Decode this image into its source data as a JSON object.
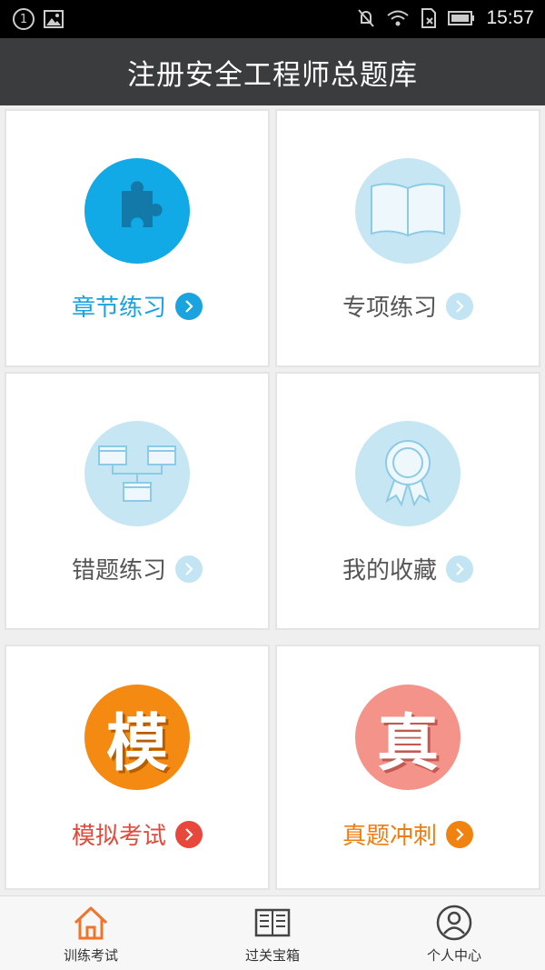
{
  "status_bar": {
    "notification_count": "1",
    "time": "15:57"
  },
  "header": {
    "title": "注册安全工程师总题库"
  },
  "cards": [
    {
      "label": "章节练习",
      "icon": "puzzle-icon",
      "label_color": "#1aa3df",
      "circle_color": "#11a9e6",
      "chevron_color": "#1aa3df"
    },
    {
      "label": "专项练习",
      "icon": "book-icon",
      "label_color": "#555555",
      "circle_color": "#c7e6f4",
      "chevron_color": "#c2e4f3"
    },
    {
      "label": "错题练习",
      "icon": "diagram-icon",
      "label_color": "#555555",
      "circle_color": "#c7e6f4",
      "chevron_color": "#c2e4f3"
    },
    {
      "label": "我的收藏",
      "icon": "award-ribbon-icon",
      "label_color": "#555555",
      "circle_color": "#c7e6f4",
      "chevron_color": "#c2e4f3"
    },
    {
      "label": "模拟考试",
      "icon": "mo-character-icon",
      "icon_text": "模",
      "label_color": "#e24a3b",
      "circle_color": "#f58a12",
      "chevron_color": "#e8473c"
    },
    {
      "label": "真题冲刺",
      "icon": "zhen-character-icon",
      "icon_text": "真",
      "label_color": "#ef7c0f",
      "circle_color": "#f4938a",
      "chevron_color": "#f08310"
    }
  ],
  "bottom_nav": [
    {
      "label": "训练考试",
      "icon": "home-icon",
      "active": true
    },
    {
      "label": "过关宝箱",
      "icon": "newspaper-icon",
      "active": false
    },
    {
      "label": "个人中心",
      "icon": "user-icon",
      "active": false
    }
  ]
}
